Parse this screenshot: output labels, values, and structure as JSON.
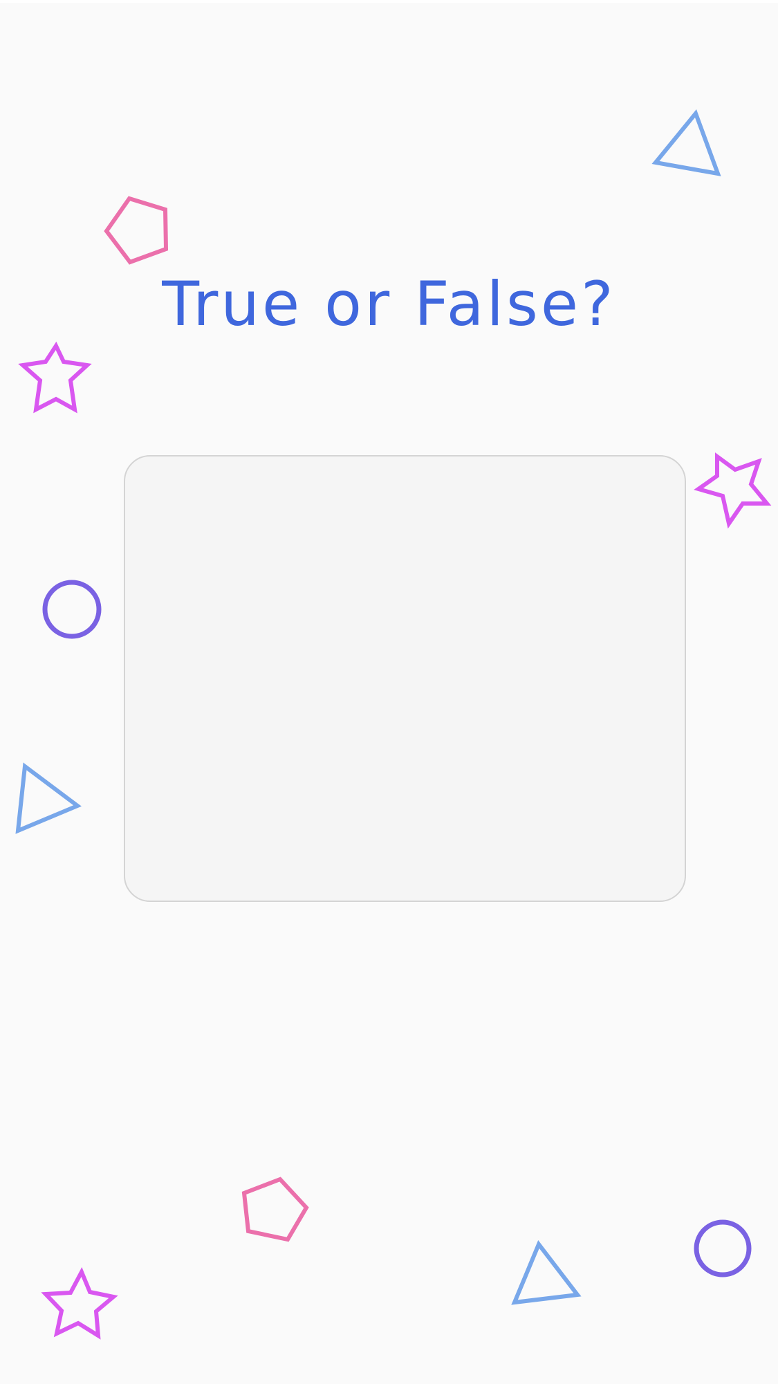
{
  "title": "True or False?",
  "colors": {
    "background": "#fafafa",
    "title": "#3f67dd",
    "card_background": "#f5f5f5",
    "card_border": "#d4d4d4",
    "pink": "#eb70ab",
    "magenta": "#d957f0",
    "blue": "#78a7ea",
    "purple": "#7a62e3"
  },
  "decorations": [
    {
      "name": "triangle-icon",
      "color": "blue"
    },
    {
      "name": "pentagon-icon",
      "color": "pink"
    },
    {
      "name": "star-icon",
      "color": "magenta"
    },
    {
      "name": "star-icon",
      "color": "magenta"
    },
    {
      "name": "circle-icon",
      "color": "purple"
    },
    {
      "name": "triangle-icon",
      "color": "blue"
    },
    {
      "name": "pentagon-icon",
      "color": "pink"
    },
    {
      "name": "circle-icon",
      "color": "purple"
    },
    {
      "name": "triangle-icon",
      "color": "blue"
    },
    {
      "name": "star-icon",
      "color": "magenta"
    }
  ]
}
